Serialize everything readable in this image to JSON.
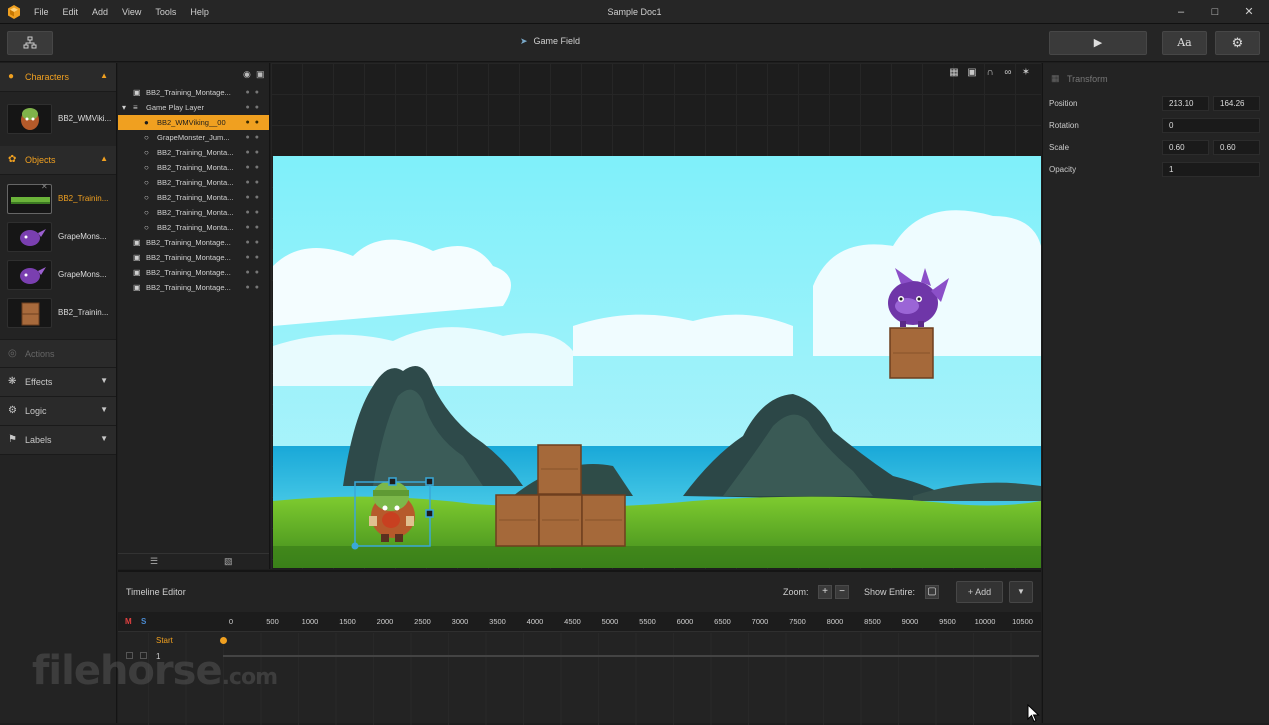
{
  "app": {
    "window_title": "Sample Doc1",
    "menu": [
      "File",
      "Edit",
      "Add",
      "View",
      "Tools",
      "Help"
    ]
  },
  "toolbar": {
    "scene_tab": "Game Field",
    "play_icon": "play-icon",
    "text_button": "Aa",
    "settings_icon": "gear-icon"
  },
  "library": {
    "characters_label": "Characters",
    "characters": [
      "BB2_WMViki..."
    ],
    "objects_label": "Objects",
    "objects": [
      "BB2_Trainin...",
      "GrapeMons...",
      "GrapeMons...",
      "BB2_Trainin..."
    ],
    "actions_label": "Actions",
    "effects_label": "Effects",
    "logic_label": "Logic",
    "labels_label": "Labels"
  },
  "layers": [
    {
      "name": "BB2_Training_Montage...",
      "indent": 0,
      "icon": "image-icon"
    },
    {
      "name": "Game Play Layer",
      "indent": 0,
      "icon": "layer-icon",
      "group": true
    },
    {
      "name": "BB2_WMViking__00",
      "indent": 1,
      "icon": "character-icon",
      "selected": true
    },
    {
      "name": "GrapeMonster_Jum...",
      "indent": 1,
      "icon": "object-icon"
    },
    {
      "name": "BB2_Training_Monta...",
      "indent": 1,
      "icon": "object-icon"
    },
    {
      "name": "BB2_Training_Monta...",
      "indent": 1,
      "icon": "object-icon"
    },
    {
      "name": "BB2_Training_Monta...",
      "indent": 1,
      "icon": "object-icon"
    },
    {
      "name": "BB2_Training_Monta...",
      "indent": 1,
      "icon": "object-icon"
    },
    {
      "name": "BB2_Training_Monta...",
      "indent": 1,
      "icon": "object-icon"
    },
    {
      "name": "BB2_Training_Monta...",
      "indent": 1,
      "icon": "object-icon"
    },
    {
      "name": "BB2_Training_Montage...",
      "indent": 0,
      "icon": "image-icon"
    },
    {
      "name": "BB2_Training_Montage...",
      "indent": 0,
      "icon": "image-icon"
    },
    {
      "name": "BB2_Training_Montage...",
      "indent": 0,
      "icon": "image-icon"
    },
    {
      "name": "BB2_Training_Montage...",
      "indent": 0,
      "icon": "image-icon"
    }
  ],
  "properties": {
    "section": "Transform",
    "position_label": "Position",
    "position_x": "213.10",
    "position_y": "164.26",
    "rotation_label": "Rotation",
    "rotation": "0",
    "scale_label": "Scale",
    "scale_x": "0.60",
    "scale_y": "0.60",
    "opacity_label": "Opacity",
    "opacity": "1"
  },
  "timeline": {
    "title": "Timeline Editor",
    "zoom_label": "Zoom:",
    "show_entire_label": "Show Entire:",
    "add_label": "+ Add",
    "m_label": "M",
    "s_label": "S",
    "ticks": [
      "0",
      "500",
      "1000",
      "1500",
      "2000",
      "2500",
      "3000",
      "3500",
      "4000",
      "4500",
      "5000",
      "5500",
      "6000",
      "6500",
      "7000",
      "7500",
      "8000",
      "8500",
      "9000",
      "9500",
      "10000",
      "10500"
    ],
    "start_label": "Start",
    "track_label": "1"
  },
  "watermark": {
    "main": "filehorse",
    "suffix": ".com"
  },
  "colors": {
    "accent": "#f0a020",
    "selection": "#3aa8d8",
    "sky": "#7ee8f5"
  }
}
